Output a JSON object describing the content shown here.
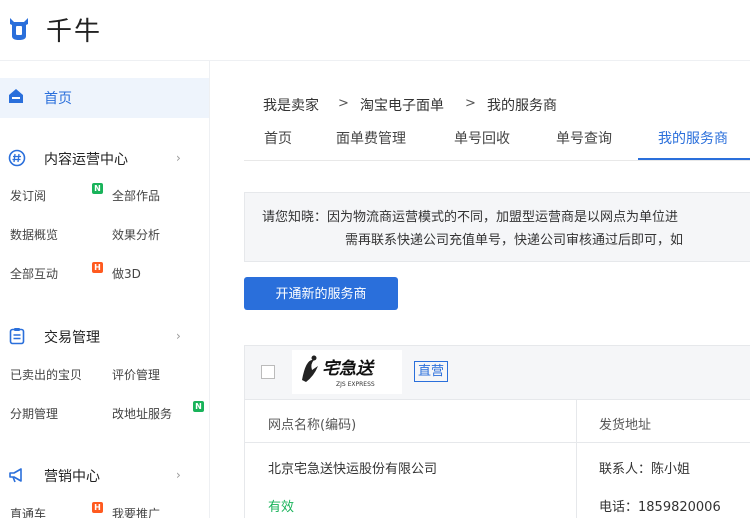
{
  "app": {
    "name": "千牛"
  },
  "sidebar": {
    "home": "首页",
    "sections": [
      {
        "label": "内容运营中心",
        "icon": "content-hash-icon",
        "items": [
          "发订阅",
          "全部作品",
          "数据概览",
          "效果分析",
          "全部互动",
          "做3D"
        ]
      },
      {
        "label": "交易管理",
        "icon": "trade-clipboard-icon",
        "items": [
          "已卖出的宝贝",
          "评价管理",
          "分期管理",
          "改地址服务"
        ]
      },
      {
        "label": "营销中心",
        "icon": "marketing-megaphone-icon",
        "items": [
          "直通车",
          "我要推广"
        ]
      }
    ],
    "badges": {
      "new": "N",
      "hot": "H"
    }
  },
  "breadcrumb": [
    "我是卖家",
    "淘宝电子面单",
    "我的服务商"
  ],
  "breadcrumb_sep": ">",
  "tabs": [
    "首页",
    "面单费管理",
    "单号回收",
    "单号查询",
    "我的服务商"
  ],
  "active_tab": "我的服务商",
  "notice": {
    "line1": "请您知晓：因为物流商运营模式的不同，加盟型运营商是以网点为单位进",
    "line2": "需再联系快递公司充值单号，快递公司审核通过后即可，如"
  },
  "open_button": "开通新的服务商",
  "provider": {
    "logo_cn": "宅急送",
    "logo_en": "ZJS EXPRESS",
    "tag": "直营",
    "columns": [
      "网点名称(编码)",
      "发货地址"
    ],
    "name": "北京宅急送快运股份有限公司",
    "status": "有效",
    "contact": "联系人：陈小姐",
    "phone": "电话：1859820006"
  },
  "colors": {
    "accent": "#2a6fdb",
    "valid_green": "#19b35a",
    "hot_badge": "#ff5a1f",
    "new_badge": "#19b35a"
  }
}
